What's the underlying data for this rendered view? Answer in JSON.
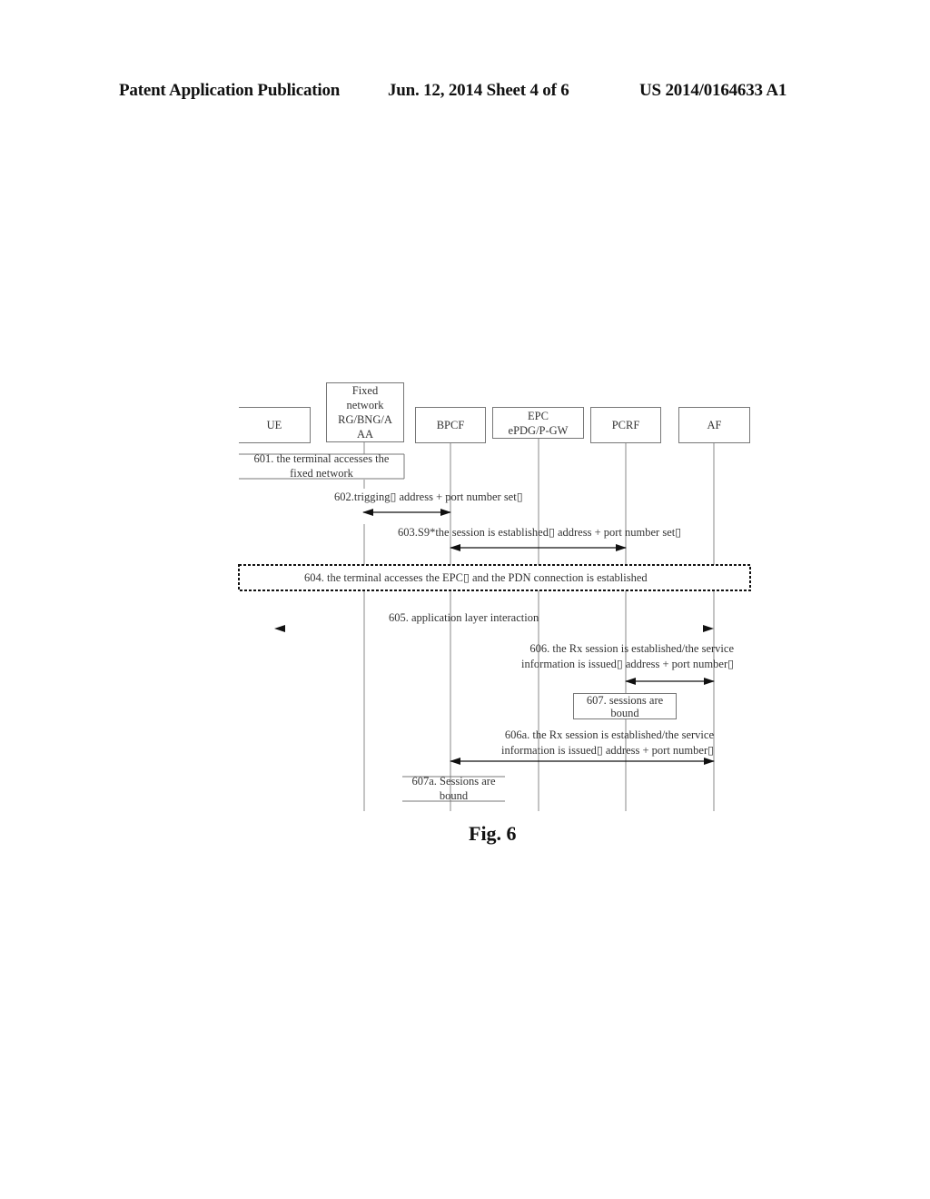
{
  "header": {
    "publication": "Patent Application Publication",
    "date_sheet": "Jun. 12, 2014  Sheet 4 of 6",
    "number": "US 2014/0164633 A1"
  },
  "figure": {
    "caption": "Fig. 6",
    "entities": [
      {
        "id": "ue",
        "label": "UE"
      },
      {
        "id": "fixed",
        "label_lines": [
          "Fixed",
          "network",
          "RG/BNG/A",
          "AA"
        ]
      },
      {
        "id": "bpcf",
        "label": "BPCF"
      },
      {
        "id": "epc",
        "label_lines": [
          "EPC",
          "ePDG/P-GW"
        ]
      },
      {
        "id": "pcrf",
        "label": "PCRF"
      },
      {
        "id": "af",
        "label": "AF"
      }
    ],
    "steps": {
      "s601": [
        "601. the terminal accesses the",
        "fixed network"
      ],
      "s602": "602.trigging▯  address + port number set▯",
      "s603": "603.S9*the session is established▯  address + port number set▯",
      "s604": "604. the terminal accesses the EPC▯  and the PDN connection is established",
      "s605": "605. application layer interaction",
      "s606": [
        "606. the Rx session is established/the service",
        "information is issued▯  address + port number▯"
      ],
      "s607": [
        "607. sessions are",
        "bound"
      ],
      "s606a": [
        "606a.  the Rx session is established/the service",
        "information is issued▯  address + port number▯"
      ],
      "s607a": [
        "607a. Sessions are",
        "bound"
      ]
    },
    "messages": [
      {
        "step": "602",
        "from": "fixed",
        "to": "bpcf",
        "direction": "bidirectional"
      },
      {
        "step": "603",
        "from": "bpcf",
        "to": "pcrf",
        "direction": "bidirectional"
      },
      {
        "step": "605",
        "from": "ue",
        "to": "af",
        "direction": "bidirectional"
      },
      {
        "step": "606",
        "from": "pcrf",
        "to": "af",
        "direction": "bidirectional"
      },
      {
        "step": "606a",
        "from": "bpcf",
        "to": "af",
        "direction": "bidirectional"
      }
    ]
  }
}
